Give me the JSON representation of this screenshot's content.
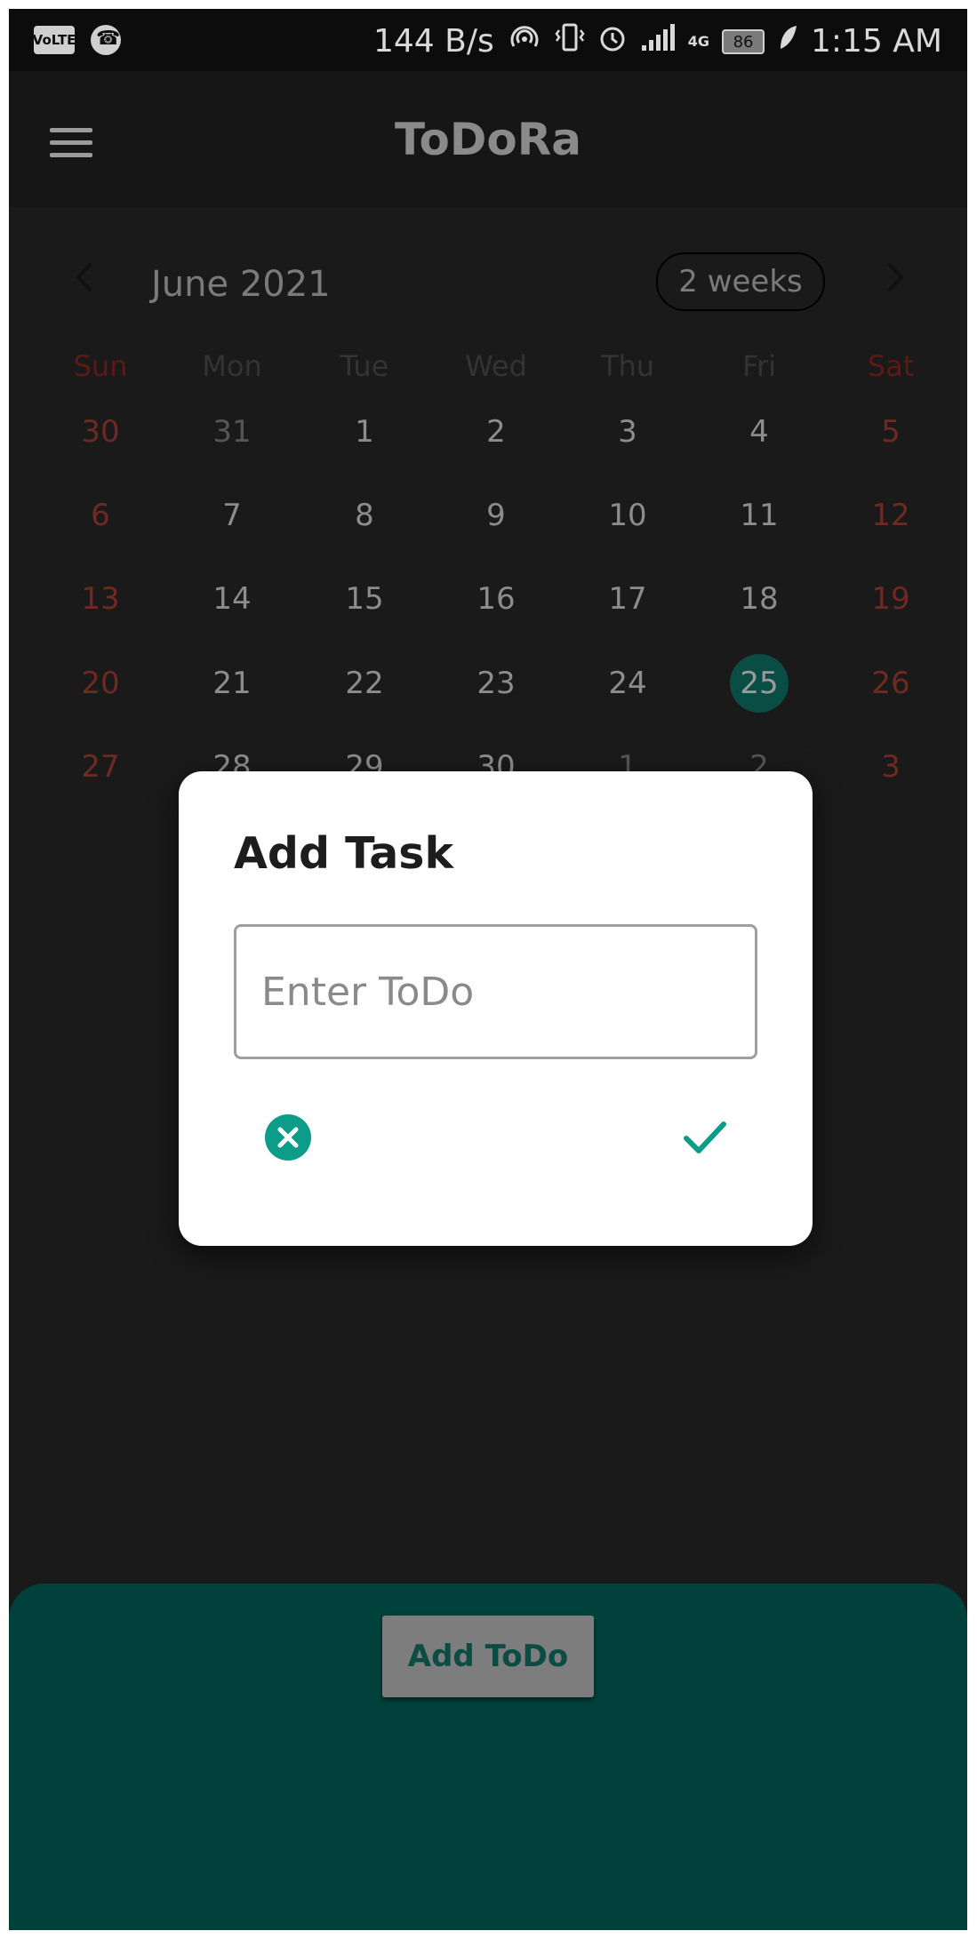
{
  "status_bar": {
    "volte": "VoLTE",
    "speed": "144 B/s",
    "hotspot_count": "1",
    "network": "4G",
    "battery": "86",
    "time": "1:15 AM"
  },
  "app_bar": {
    "title": "ToDoRa",
    "menu_icon": "hamburger-menu-icon"
  },
  "calendar": {
    "month_label": "June 2021",
    "format_button": "2 weeks",
    "prev_icon": "chevron-left-icon",
    "next_icon": "chevron-right-icon",
    "days_of_week": [
      "Sun",
      "Mon",
      "Tue",
      "Wed",
      "Thu",
      "Fri",
      "Sat"
    ],
    "weeks": [
      [
        "30",
        "31",
        "1",
        "2",
        "3",
        "4",
        "5"
      ],
      [
        "6",
        "7",
        "8",
        "9",
        "10",
        "11",
        "12"
      ],
      [
        "13",
        "14",
        "15",
        "16",
        "17",
        "18",
        "19"
      ],
      [
        "20",
        "21",
        "22",
        "23",
        "24",
        "25",
        "26"
      ],
      [
        "27",
        "28",
        "29",
        "30",
        "1",
        "2",
        "3"
      ]
    ],
    "selected_day": "25",
    "selected_color": "#0a4d44",
    "weekend_color": "#6e2a22"
  },
  "dialog": {
    "title": "Add Task",
    "input_placeholder": "Enter ToDo",
    "input_value": "",
    "cancel_icon": "cancel-circle-icon",
    "confirm_icon": "checkmark-icon",
    "accent_color": "#0c9c87"
  },
  "bottom_panel": {
    "add_button_label": "Add ToDo",
    "panel_color": "#00423b"
  }
}
